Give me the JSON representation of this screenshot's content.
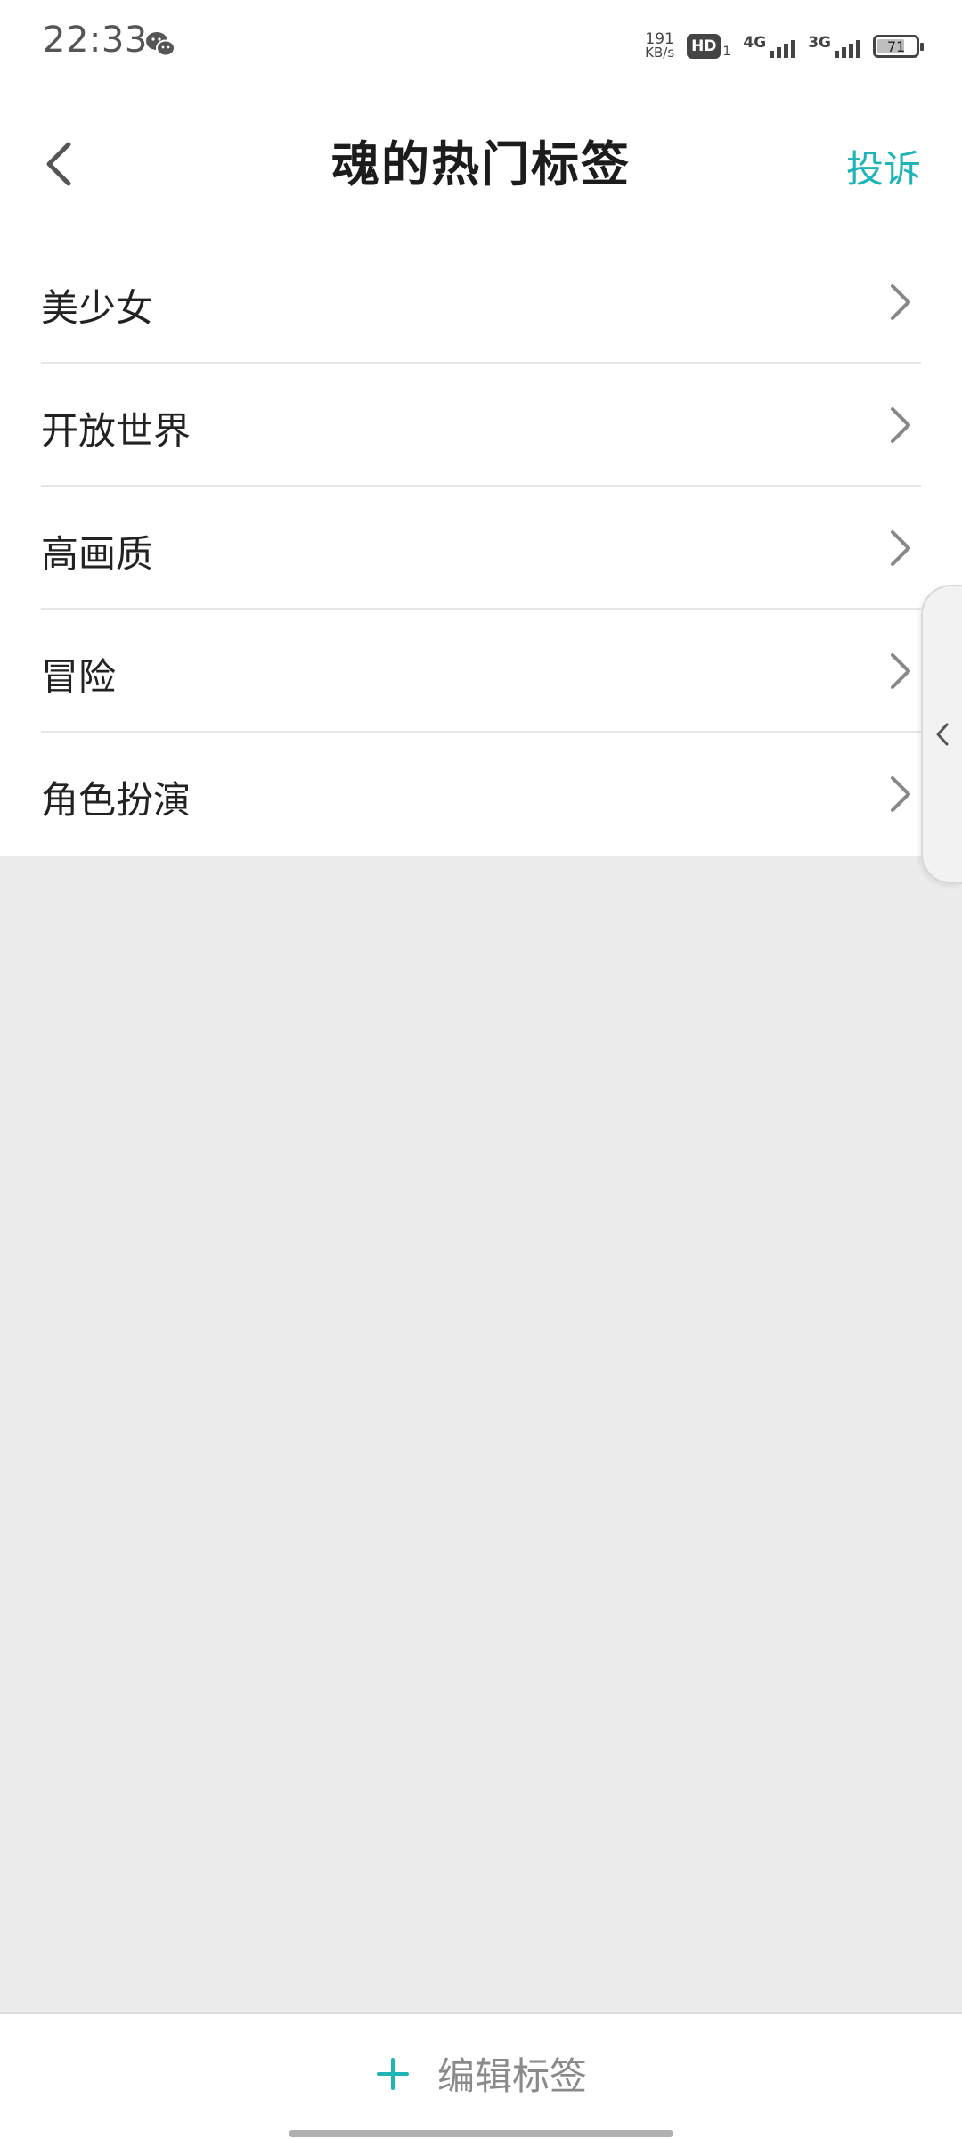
{
  "status_bar": {
    "time": "22:33",
    "net_speed_value": "191",
    "net_speed_unit": "KB/s",
    "hd_label": "HD",
    "hd_sub": "1",
    "sim1_type": "4G",
    "sim2_type": "3G",
    "battery_level": "71",
    "battery_fraction": 0.71
  },
  "header": {
    "title": "魂的热门标签",
    "report_label": "投诉"
  },
  "tags": [
    {
      "label": "美少女"
    },
    {
      "label": "开放世界"
    },
    {
      "label": "高画质"
    },
    {
      "label": "冒险"
    },
    {
      "label": "角色扮演"
    }
  ],
  "bottom": {
    "edit_label": "编辑标签"
  },
  "colors": {
    "accent": "#1fb5b8",
    "background": "#ececec"
  }
}
